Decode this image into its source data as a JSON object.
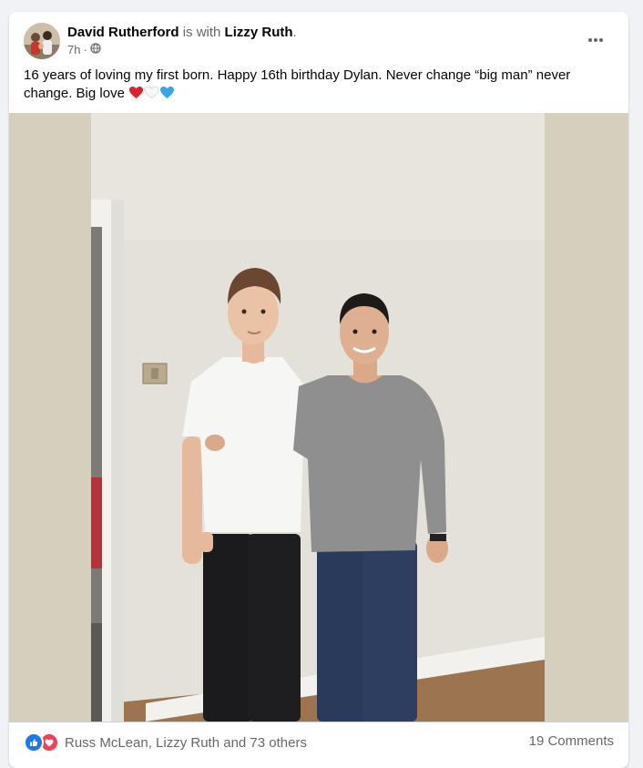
{
  "post": {
    "author": "David Rutherford",
    "with_prefix": "is with",
    "with_name": "Lizzy Ruth",
    "with_suffix": ".",
    "time": "7h",
    "separator": "·",
    "privacy_icon": "globe-icon",
    "caption_text": "16 years of loving my first born. Happy 16th birthday Dylan.  Never change “big man” never change. Big love ",
    "caption_emojis": [
      "red-heart-icon",
      "white-heart-icon",
      "blue-heart-icon"
    ],
    "more_icon": "more-options-icon"
  },
  "footer": {
    "reaction_icons": [
      "like-icon",
      "love-icon"
    ],
    "reaction_text": "Russ McLean, Lizzy Ruth and 73 others",
    "comments_text": "19 Comments"
  },
  "colors": {
    "like": "#1877f2",
    "love": "#f33e58",
    "secondary_text": "#65676b",
    "page_bg": "#f0f2f5"
  }
}
